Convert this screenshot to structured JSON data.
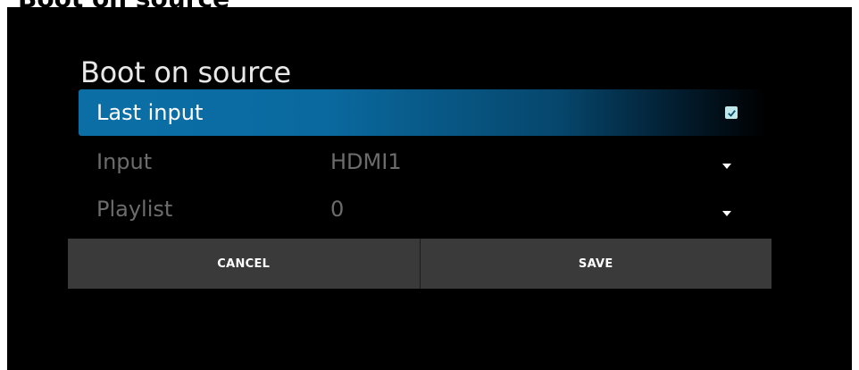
{
  "header_partial": "Boot on source",
  "dialog": {
    "title": "Boot on source",
    "last_input": {
      "label": "Last input",
      "checked": true
    },
    "input": {
      "label": "Input",
      "value": "HDMI1"
    },
    "playlist": {
      "label": "Playlist",
      "value": "0"
    },
    "buttons": {
      "cancel": "CANCEL",
      "save": "SAVE"
    }
  },
  "colors": {
    "highlight": "#0b6fa6",
    "checkbox": "#bfe8ea",
    "button_bg": "#3a3a3a",
    "dim_text": "#6c6c6c"
  },
  "icons": {
    "checkbox": "checkbox-checked-icon",
    "dropdown": "dropdown-arrow-icon"
  }
}
